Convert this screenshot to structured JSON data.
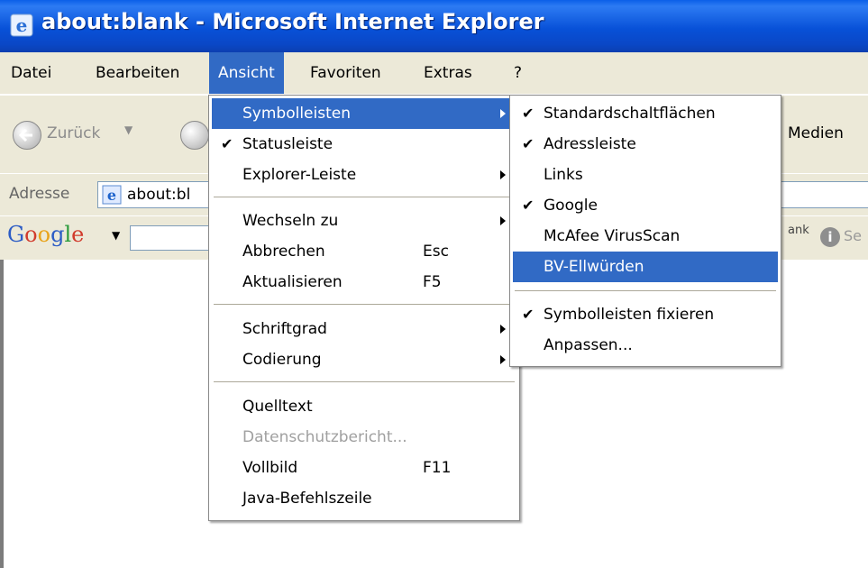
{
  "window": {
    "title": "about:blank - Microsoft Internet Explorer"
  },
  "menubar": {
    "items": [
      "Datei",
      "Bearbeiten",
      "Ansicht",
      "Favoriten",
      "Extras",
      "?"
    ],
    "active": "Ansicht"
  },
  "toolbar": {
    "back_label": "Zurück",
    "media_label": "Medien"
  },
  "address": {
    "label": "Adresse",
    "value": "about:bl"
  },
  "googlebar": {
    "logo": "Google",
    "right_text": "ank",
    "se_text": "Se"
  },
  "view_menu": {
    "items": [
      {
        "label": "Symbolleisten",
        "submenu": true,
        "highlighted": true
      },
      {
        "label": "Statusleiste",
        "checked": true
      },
      {
        "label": "Explorer-Leiste",
        "submenu": true
      },
      {
        "label": "Wechseln zu",
        "submenu": true
      },
      {
        "label": "Abbrechen",
        "shortcut": "Esc"
      },
      {
        "label": "Aktualisieren",
        "shortcut": "F5"
      },
      {
        "label": "Schriftgrad",
        "submenu": true
      },
      {
        "label": "Codierung",
        "submenu": true
      },
      {
        "label": "Quelltext"
      },
      {
        "label": "Datenschutzbericht...",
        "disabled": true
      },
      {
        "label": "Vollbild",
        "shortcut": "F11"
      },
      {
        "label": "Java-Befehlszeile"
      }
    ]
  },
  "toolbars_submenu": {
    "items": [
      {
        "label": "Standardschaltflächen",
        "checked": true
      },
      {
        "label": "Adressleiste",
        "checked": true
      },
      {
        "label": "Links"
      },
      {
        "label": "Google",
        "checked": true
      },
      {
        "label": "McAfee VirusScan"
      },
      {
        "label": "BV-Ellwürden",
        "highlighted": true
      },
      {
        "label": "Symbolleisten fixieren",
        "checked": true
      },
      {
        "label": "Anpassen..."
      }
    ]
  },
  "colors": {
    "titlebar": "#0a47c6",
    "highlight": "#316ac5",
    "chrome": "#ece9d8"
  }
}
